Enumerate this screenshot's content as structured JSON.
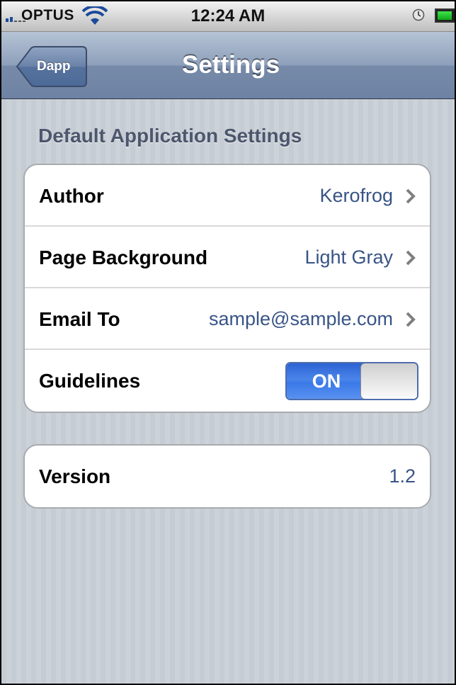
{
  "status_bar": {
    "carrier": "OPTUS",
    "time": "12:24 AM",
    "icons": [
      "signal-icon",
      "wifi-icon",
      "lock-rotation-icon",
      "battery-icon"
    ]
  },
  "nav_bar": {
    "back_label": "Dapp",
    "title": "Settings"
  },
  "section_1": {
    "header": "Default Application Settings",
    "rows": [
      {
        "label": "Author",
        "value": "Kerofrog"
      },
      {
        "label": "Page Background",
        "value": "Light Gray"
      },
      {
        "label": "Email To",
        "value": "sample@sample.com"
      },
      {
        "label": "Guidelines",
        "toggle": "ON"
      }
    ]
  },
  "section_2": {
    "rows": [
      {
        "label": "Version",
        "value": "1.2"
      }
    ]
  },
  "colors": {
    "nav_bar": "#8d9fba",
    "background": "#c5ccd4",
    "value_text": "#385487",
    "toggle_on": "#3a79e7",
    "section_header": "#4c566c"
  }
}
